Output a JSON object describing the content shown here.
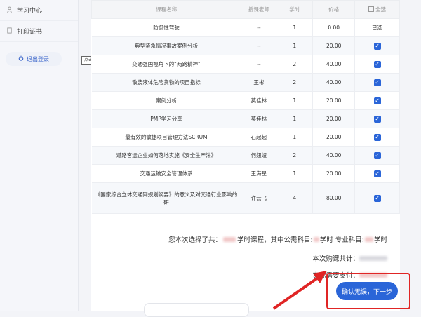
{
  "sidebar": {
    "items": [
      {
        "label": "学习中心",
        "icon": "user-icon"
      },
      {
        "label": "打印证书",
        "icon": "document-icon"
      }
    ],
    "logout_label": "退出登录",
    "logout_icon": "power-icon"
  },
  "tooltip": "点击任意位置关闭",
  "table": {
    "headers": [
      "课程名称",
      "授课老师",
      "学时",
      "价格",
      "全选"
    ],
    "rows": [
      {
        "name": "防御性驾驶",
        "teacher": "--",
        "hours": "1",
        "price": "0.00",
        "status": "已选",
        "checked": false
      },
      {
        "name": "典型紧急情况事故案例分析",
        "teacher": "--",
        "hours": "1",
        "price": "20.00",
        "status": "",
        "checked": true
      },
      {
        "name": "交通强国视角下的“两路精神”",
        "teacher": "--",
        "hours": "2",
        "price": "40.00",
        "status": "",
        "checked": true
      },
      {
        "name": "散装液体危险货物的项目指标",
        "teacher": "王彬",
        "hours": "2",
        "price": "40.00",
        "status": "",
        "checked": true
      },
      {
        "name": "案例分析",
        "teacher": "莫佳林",
        "hours": "1",
        "price": "20.00",
        "status": "",
        "checked": true
      },
      {
        "name": "PMP学习分享",
        "teacher": "莫佳林",
        "hours": "1",
        "price": "20.00",
        "status": "",
        "checked": true
      },
      {
        "name": "最有效的敏捷项目管理方法SCRUM",
        "teacher": "石起起",
        "hours": "1",
        "price": "20.00",
        "status": "",
        "checked": true
      },
      {
        "name": "道路客运企业如何落地实施《安全生产法》",
        "teacher": "何妞妞",
        "hours": "2",
        "price": "40.00",
        "status": "",
        "checked": true
      },
      {
        "name": "交通运输安全管理体系",
        "teacher": "王海星",
        "hours": "1",
        "price": "20.00",
        "status": "",
        "checked": true
      },
      {
        "name": "《国家综合立体交通网规划纲要》的意义及对交通行业影响的研",
        "teacher": "许云飞",
        "hours": "4",
        "price": "80.00",
        "status": "",
        "checked": true
      }
    ]
  },
  "summary": {
    "line1_prefix": "您本次选择了共：",
    "line1_a": "学时课程，其中公需科目:",
    "line1_b": "学时 专业科目:",
    "line1_c": "学时",
    "line2": "本次购课共计：",
    "line3": "实际需要支付："
  },
  "confirm_label": "确认无误，下一步",
  "colors": {
    "accent": "#2a65d8",
    "highlight": "#e02525"
  }
}
